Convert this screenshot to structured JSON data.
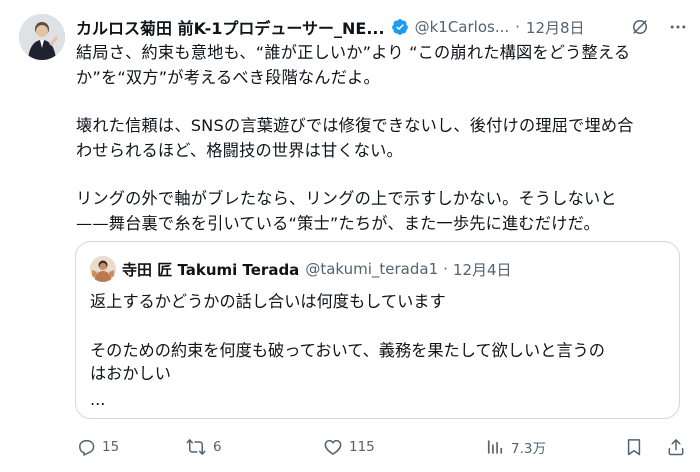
{
  "tweet": {
    "author_name": "カルロス菊田 前K-1プロデューサー_NE...",
    "handle": "@k1Carlos...",
    "separator": "·",
    "date": "12月8日",
    "body": [
      "結局さ、約束も意地も、“誰が正しいか”より “この崩れた構図をどう整える",
      "か”を“双方”が考えるべき段階なんだよ。",
      "",
      "壊れた信頼は、SNSの言葉遊びでは修復できないし、後付けの理屈で埋め合",
      "わせられるほど、格闘技の世界は甘くない。",
      "",
      "リングの外で軸がブレたなら、リングの上で示すしかない。そうしないと",
      "——舞台裏で糸を引いている“策士”たちが、また一歩先に進むだけだ。"
    ]
  },
  "quoted": {
    "author_name": "寺田 匠 Takumi Terada",
    "handle": "@takumi_terada1",
    "separator": "·",
    "date": "12月4日",
    "body": [
      "返上するかどうかの話し合いは何度もしています",
      "",
      "そのための約束を何度も破っておいて、義務を果たして欲しいと言うの",
      "はおかしい",
      "..."
    ]
  },
  "actions": {
    "replies": "15",
    "reposts": "6",
    "likes": "115",
    "views": "7.3万"
  },
  "icons": {
    "verified": "verified-badge-icon",
    "grok": "grok-icon",
    "reply": "reply-icon",
    "repost": "repost-icon",
    "like": "like-icon",
    "views": "views-icon",
    "bookmark": "bookmark-icon",
    "share": "share-icon"
  },
  "colors": {
    "verified": "#1d9bf0",
    "text": "#0f1419",
    "muted": "#536471",
    "border": "#cfd9de"
  }
}
